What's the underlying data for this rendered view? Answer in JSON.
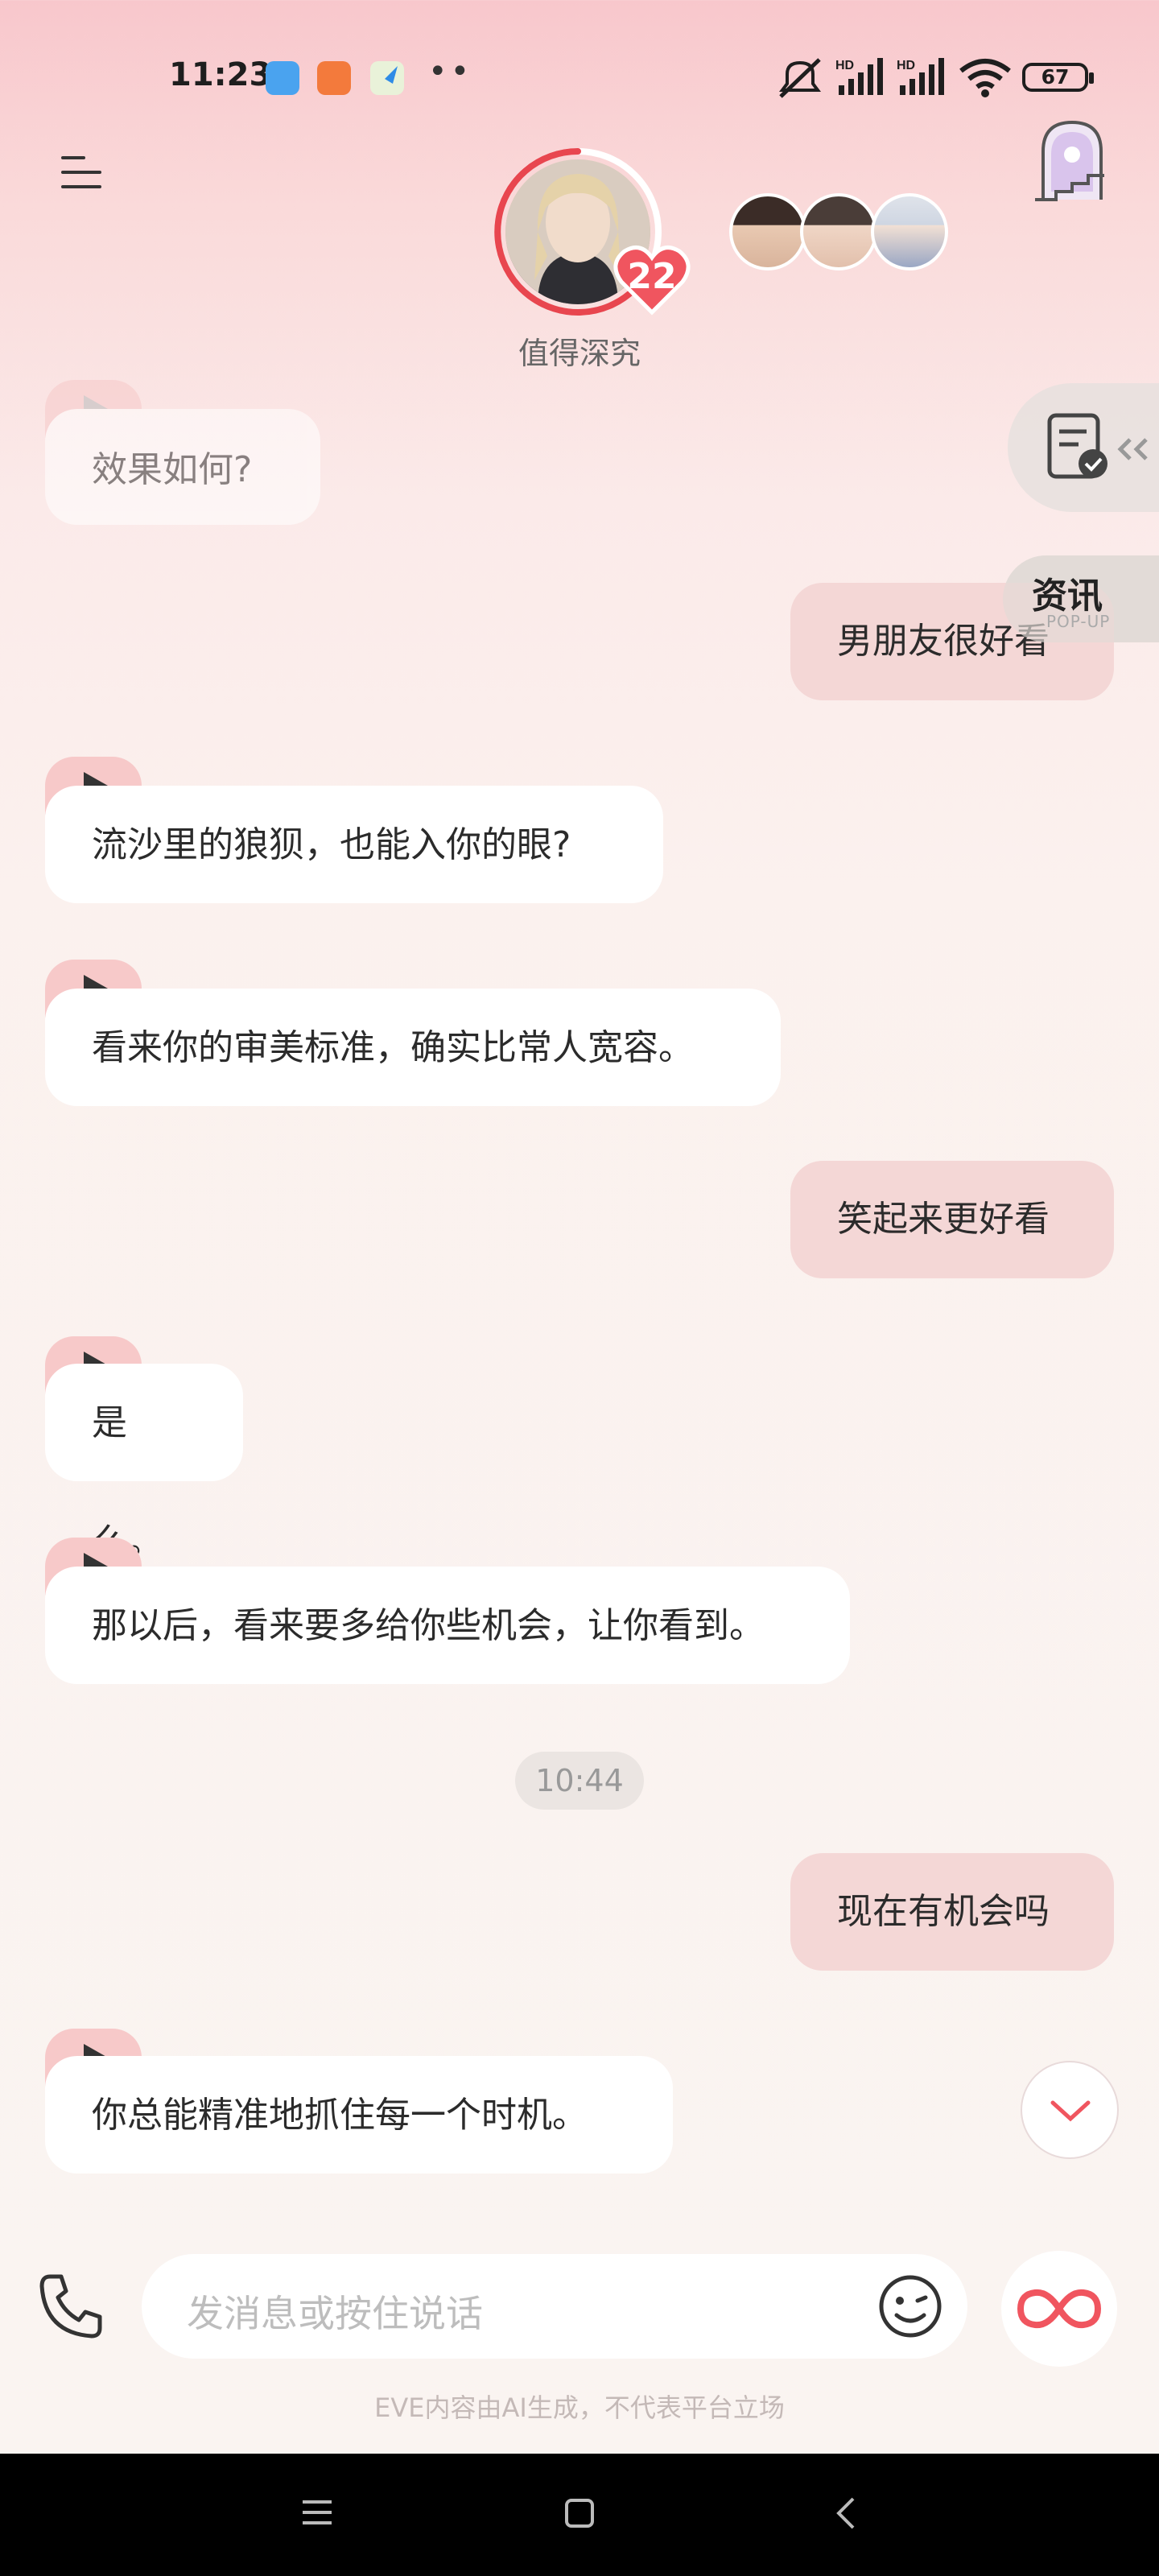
{
  "status_bar": {
    "time": "11:23",
    "battery": "67",
    "signal_labels": [
      "HD",
      "HD"
    ]
  },
  "header": {
    "avatar_caption": "值得深究",
    "heart_count": "22"
  },
  "side": {
    "news_title": "资讯",
    "news_subtitle": "POP-UP"
  },
  "messages": [
    {
      "side": "in",
      "text": "效果如何?"
    },
    {
      "side": "out",
      "text": "男朋友很好看"
    },
    {
      "side": "in",
      "text": "流沙里的狼狈，也能入你的眼?"
    },
    {
      "side": "in",
      "text": "看来你的审美标准，确实比常人宽容。"
    },
    {
      "side": "out",
      "text": "笑起来更好看"
    },
    {
      "side": "in",
      "text": "是么。"
    },
    {
      "side": "in",
      "text": "那以后，看来要多给你些机会，让你看到。"
    },
    {
      "side": "out",
      "text": "现在有机会吗"
    },
    {
      "side": "in",
      "text": "你总能精准地抓住每一个时机。"
    }
  ],
  "timestamp": "10:44",
  "input": {
    "placeholder": "发消息或按住说话"
  },
  "disclaimer": "EVE内容由AI生成，不代表平台立场",
  "colors": {
    "accent": "#f0555f",
    "bubble_out": "#f4d7d6",
    "bubble_in": "#ffffff"
  }
}
